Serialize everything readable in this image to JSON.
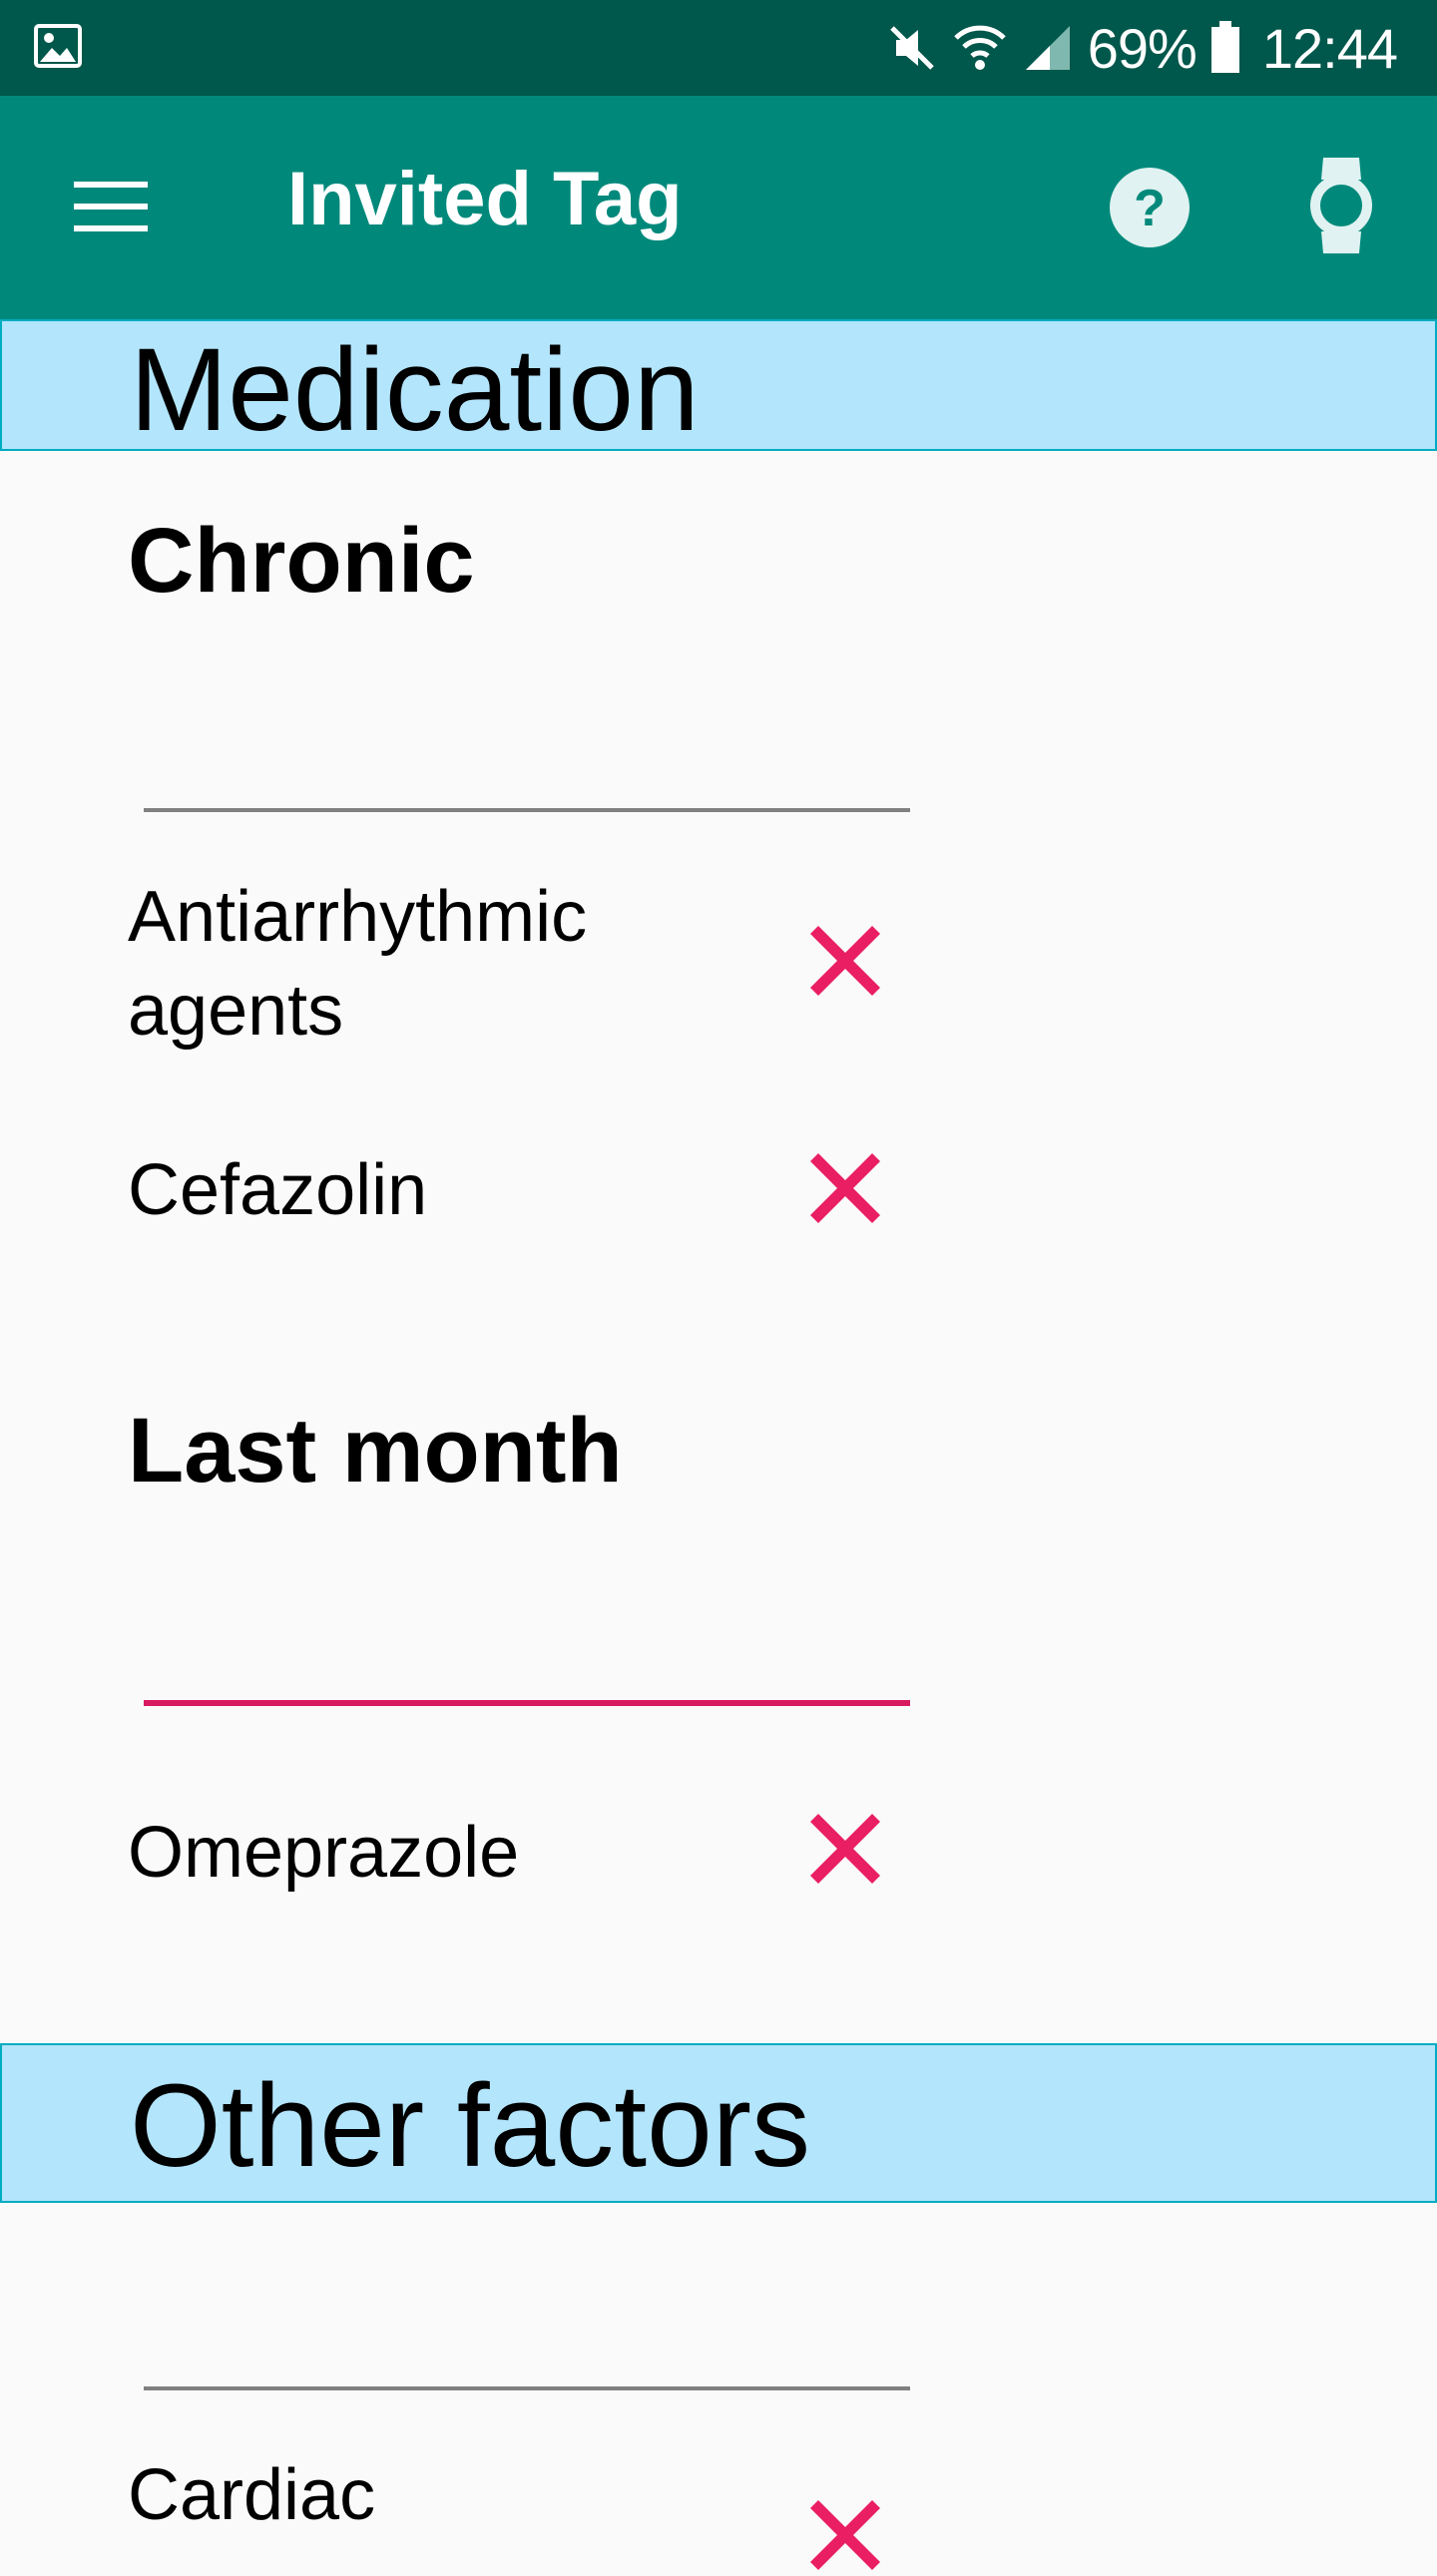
{
  "status_bar": {
    "battery_percent": "69%",
    "time": "12:44",
    "icons": [
      "gallery-icon",
      "mute-icon",
      "wifi-icon",
      "signal-icon",
      "battery-icon"
    ]
  },
  "app_bar": {
    "title": "Invited Tag",
    "icons": [
      "menu-icon",
      "help-icon",
      "watch-icon"
    ]
  },
  "sections": {
    "medication": {
      "title": "Medication",
      "chronic": {
        "heading": "Chronic",
        "items": [
          "Antiarrhythmic agents",
          "Cefazolin"
        ]
      },
      "last_month": {
        "heading": "Last month",
        "items": [
          "Omeprazole"
        ]
      }
    },
    "other_factors": {
      "title": "Other factors",
      "items": [
        "Cardiac"
      ]
    }
  },
  "colors": {
    "status_bar": "#00574b",
    "app_bar": "#00897b",
    "section_header_bg": "#b3e5fc",
    "section_header_border": "#00acc1",
    "remove_icon": "#e91e63",
    "active_field_line": "#d81b60"
  }
}
